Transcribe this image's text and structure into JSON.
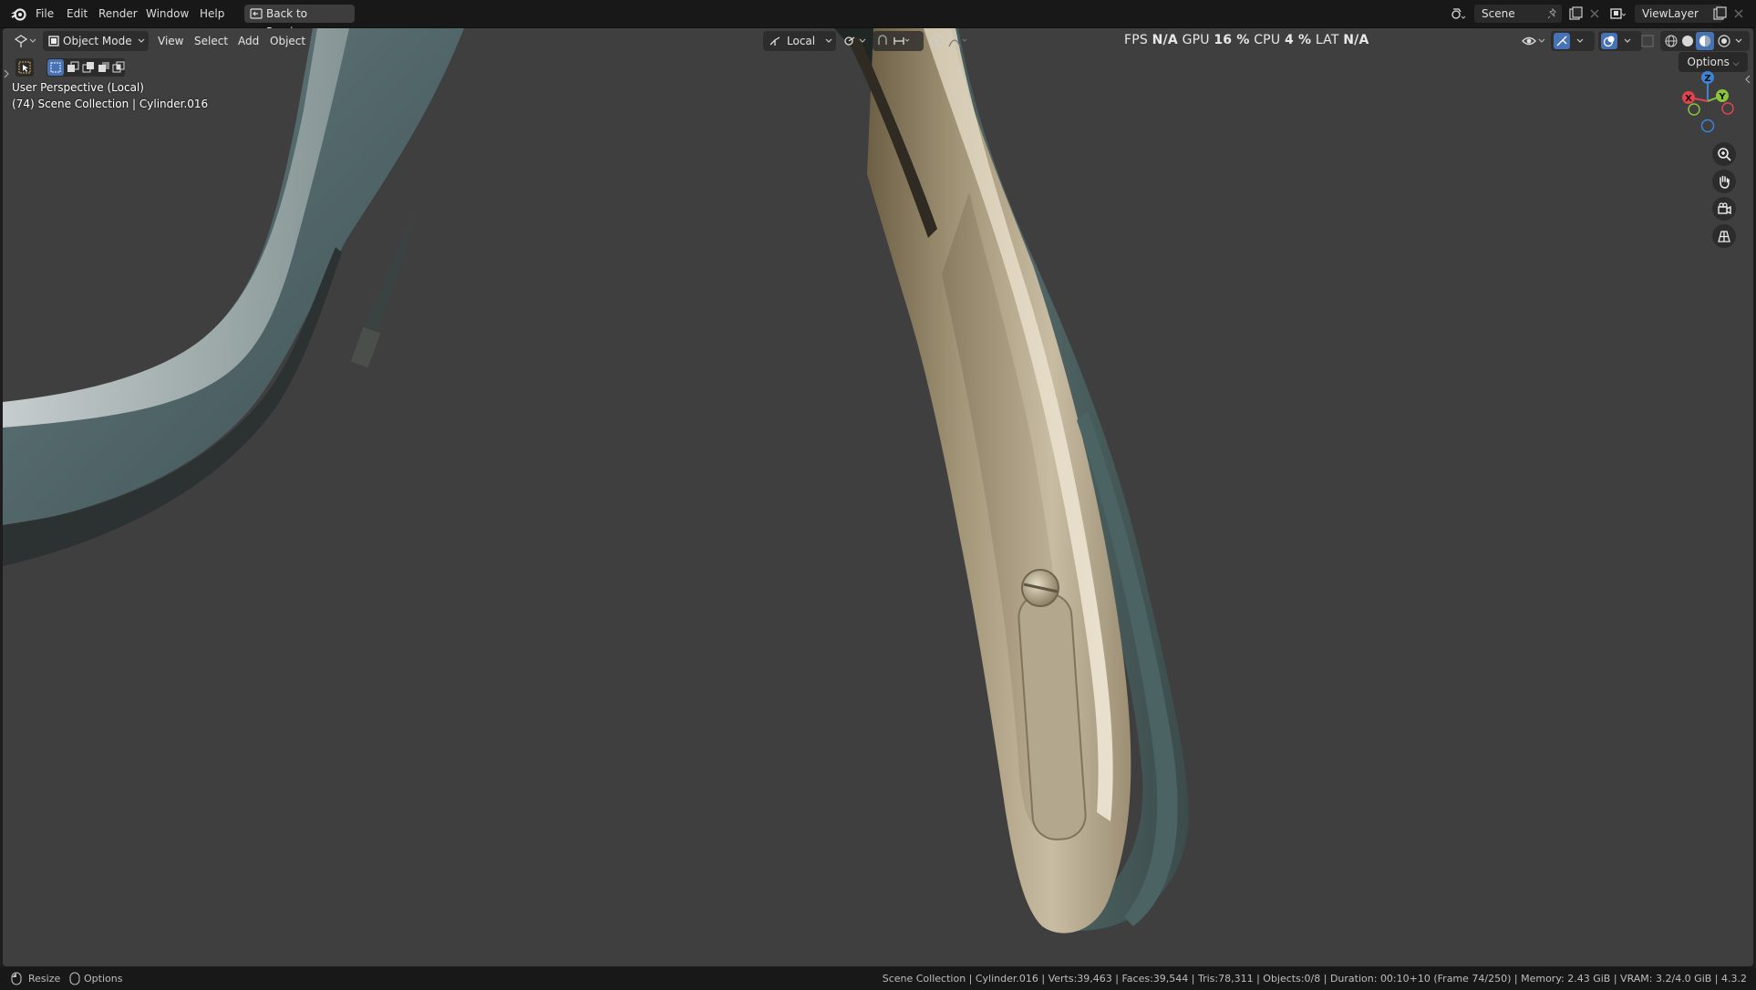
{
  "menubar": {
    "items": [
      "File",
      "Edit",
      "Render",
      "Window",
      "Help"
    ],
    "back_button": "Back to Previous",
    "scene_name": "Scene",
    "view_layer": "ViewLayer"
  },
  "viewport_header": {
    "mode": "Object Mode",
    "menus": [
      "View",
      "Select",
      "Add",
      "Object"
    ],
    "orientation": "Local",
    "stats": {
      "fps_label": "FPS",
      "fps_value": "N/A",
      "gpu_label": "GPU",
      "gpu_value": "16 %",
      "cpu_label": "CPU",
      "cpu_value": "4 %",
      "lat_label": "LAT",
      "lat_value": "N/A"
    },
    "options_label": "Options"
  },
  "overlay": {
    "view_name": "User Perspective (Local)",
    "collection_info": "(74) Scene Collection | Cylinder.016"
  },
  "gizmo": {
    "x_label": "X",
    "y_label": "Y",
    "z_label": "Z"
  },
  "statusbar": {
    "left_action_1": "Resize",
    "left_action_2": "Options",
    "info": "Scene Collection | Cylinder.016 | Verts:39,463 | Faces:39,544 | Tris:78,311 | Objects:0/8 | Duration: 00:10+10 (Frame 74/250) | Memory: 2.43 GiB | VRAM: 3.2/4.0 GiB | 4.3.2"
  },
  "colors": {
    "viewport_bg": "#3f3f3f",
    "metal_teal": "#4f6a6c",
    "metal_gold": "#b8ab90",
    "axis_x": "#e2434f",
    "axis_y": "#8bc43a",
    "axis_z": "#3c84d6"
  }
}
